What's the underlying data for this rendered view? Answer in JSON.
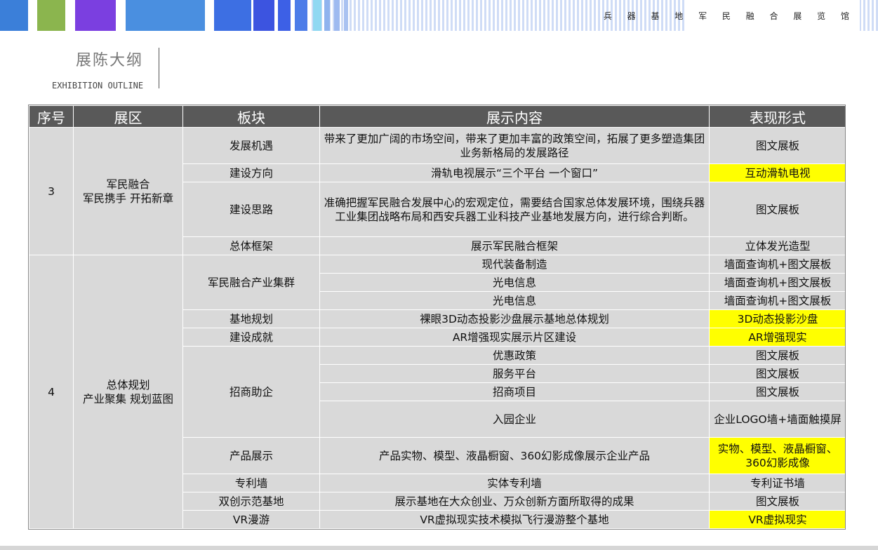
{
  "header": {
    "brand": "兵 器 基 地 军 民 融 合 展 览 馆",
    "stripe_colors": [
      "#3b7fd9",
      "#8bb54e",
      "#7b3fe0",
      "#4a8fe0",
      "#3d6fe3",
      "#3c54e0"
    ]
  },
  "title": {
    "main": "展陈大纲",
    "sub": "EXHIBITION OUTLINE"
  },
  "table": {
    "headers": [
      "序号",
      "展区",
      "板块",
      "展示内容",
      "表现形式"
    ],
    "highlight_color": "#ffff00",
    "sections": [
      {
        "no": "3",
        "zone": "军民融合\n军民携手 开拓新章",
        "blocks": [
          {
            "name": "发展机遇",
            "rows": [
              {
                "content": "带来了更加广阔的市场空间，带来了更加丰富的政策空间，拓展了更多塑造集团业务新格局的发展路径",
                "form": "图文展板",
                "highlight": false
              }
            ]
          },
          {
            "name": "建设方向",
            "rows": [
              {
                "content": "滑轨电视展示“三个平台 一个窗口”",
                "form": "互动滑轨电视",
                "highlight": true
              }
            ]
          },
          {
            "name": "建设思路",
            "rows": [
              {
                "content": "准确把握军民融合发展中心的宏观定位，需要结合国家总体发展环境，围绕兵器工业集团战略布局和西安兵器工业科技产业基地发展方向，进行综合判断。",
                "form": "图文展板",
                "highlight": false
              }
            ]
          },
          {
            "name": "总体框架",
            "rows": [
              {
                "content": "展示军民融合框架",
                "form": "立体发光造型",
                "highlight": false
              }
            ]
          }
        ]
      },
      {
        "no": "4",
        "zone": "总体规划\n产业聚集 规划蓝图",
        "blocks": [
          {
            "name": "军民融合产业集群",
            "rows": [
              {
                "content": "现代装备制造",
                "form": "墙面查询机+图文展板",
                "highlight": false
              },
              {
                "content": "光电信息",
                "form": "墙面查询机+图文展板",
                "highlight": false
              },
              {
                "content": "光电信息",
                "form": "墙面查询机+图文展板",
                "highlight": false
              }
            ]
          },
          {
            "name": "基地规划",
            "rows": [
              {
                "content": "裸眼3D动态投影沙盘展示基地总体规划",
                "form": "3D动态投影沙盘",
                "highlight": true
              }
            ]
          },
          {
            "name": "建设成就",
            "rows": [
              {
                "content": "AR增强现实展示片区建设",
                "form": "AR增强现实",
                "highlight": true
              }
            ]
          },
          {
            "name": "招商助企",
            "rows": [
              {
                "content": "优惠政策",
                "form": "图文展板",
                "highlight": false
              },
              {
                "content": "服务平台",
                "form": "图文展板",
                "highlight": false
              },
              {
                "content": "招商项目",
                "form": "图文展板",
                "highlight": false
              },
              {
                "content": "入园企业",
                "form": "企业LOGO墙+墙面触摸屏",
                "highlight": false
              }
            ]
          },
          {
            "name": "产品展示",
            "rows": [
              {
                "content": "产品实物、模型、液晶橱窗、360幻影成像展示企业产品",
                "form": "实物、模型、液晶橱窗、360幻影成像",
                "highlight": true
              }
            ]
          },
          {
            "name": "专利墙",
            "rows": [
              {
                "content": "实体专利墙",
                "form": "专利证书墙",
                "highlight": false
              }
            ]
          },
          {
            "name": "双创示范基地",
            "rows": [
              {
                "content": "展示基地在大众创业、万众创新方面所取得的成果",
                "form": "图文展板",
                "highlight": false
              }
            ]
          },
          {
            "name": "VR漫游",
            "rows": [
              {
                "content": "VR虚拟现实技术模拟飞行漫游整个基地",
                "form": "VR虚拟现实",
                "highlight": true
              }
            ]
          }
        ]
      }
    ]
  }
}
